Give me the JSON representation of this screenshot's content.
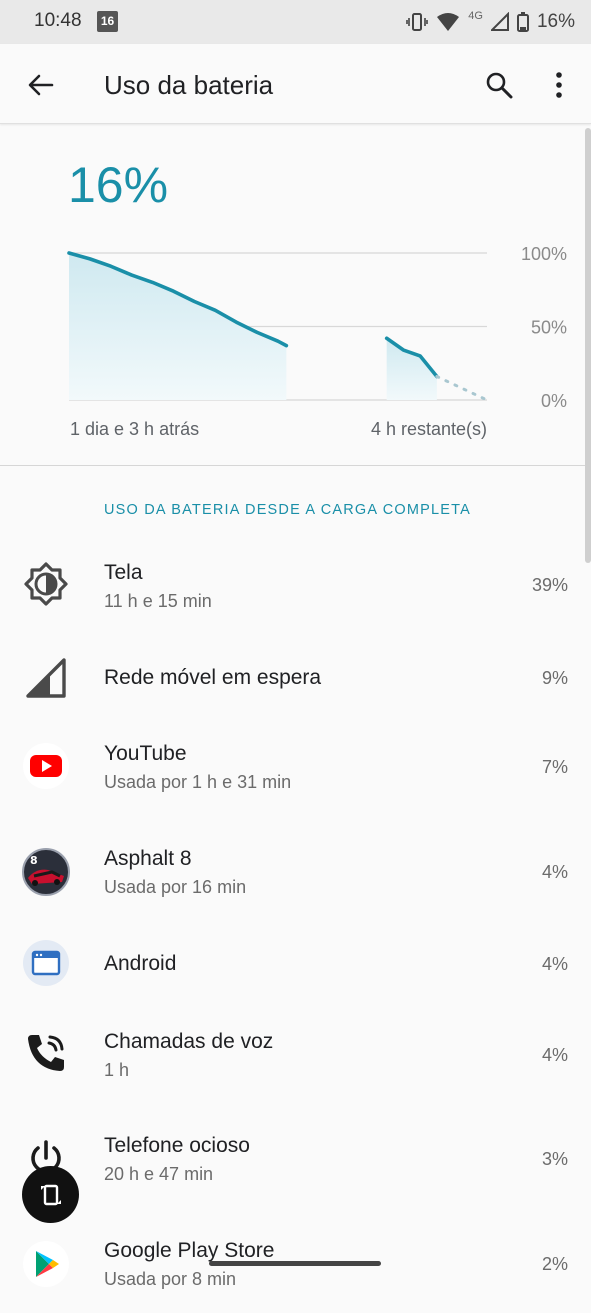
{
  "status_bar": {
    "time": "10:48",
    "notification_badge": "16",
    "network": "4G",
    "battery": "16%"
  },
  "app_bar": {
    "title": "Uso da bateria",
    "icons": [
      "back-arrow-icon",
      "search-icon",
      "more-vert-icon"
    ]
  },
  "summary": {
    "battery_percent": "16%",
    "time_ago": "1 dia e 3 h atrás",
    "time_remaining": "4 h restante(s)"
  },
  "chart_data": {
    "type": "area",
    "ylim": [
      0,
      100
    ],
    "ytick_labels": [
      "100%",
      "50%",
      "0%"
    ],
    "grid": true,
    "series": [
      {
        "x": [
          0,
          0.05,
          0.1,
          0.15,
          0.2,
          0.25,
          0.3,
          0.35,
          0.4,
          0.45,
          0.5,
          0.52
        ],
        "y": [
          100,
          96,
          91,
          85,
          80,
          74,
          67,
          61,
          53,
          46,
          40,
          37
        ]
      },
      {
        "x": [
          0.76,
          0.8,
          0.84,
          0.88
        ],
        "y": [
          42,
          34,
          30,
          16
        ]
      }
    ],
    "projection": {
      "x": [
        0.88,
        1.0
      ],
      "y": [
        16,
        0
      ]
    },
    "colors": {
      "line": "#1a8fa8",
      "fill": "#e3f3f7",
      "projection": "#a9c7d0",
      "grid": "#d8d8d8"
    }
  },
  "section_header": "USO DA BATERIA DESDE A CARGA COMPLETA",
  "items": [
    {
      "title": "Tela",
      "subtitle": "11 h e 15 min",
      "percent": "39%",
      "icon": "brightness-icon"
    },
    {
      "title": "Rede móvel em espera",
      "subtitle": "",
      "percent": "9%",
      "icon": "cell-signal-icon"
    },
    {
      "title": "YouTube",
      "subtitle": "Usada por 1 h e 31 min",
      "percent": "7%",
      "icon": "youtube-icon"
    },
    {
      "title": "Asphalt 8",
      "subtitle": "Usada por 16 min",
      "percent": "4%",
      "icon": "asphalt-8-icon"
    },
    {
      "title": "Android",
      "subtitle": "",
      "percent": "4%",
      "icon": "android-os-icon"
    },
    {
      "title": "Chamadas de voz",
      "subtitle": "1 h",
      "percent": "4%",
      "icon": "phone-call-icon"
    },
    {
      "title": "Telefone ocioso",
      "subtitle": "20 h e 47 min",
      "percent": "3%",
      "icon": "power-icon"
    },
    {
      "title": "Google Play Store",
      "subtitle": "Usada por 8 min",
      "percent": "2%",
      "icon": "play-store-icon"
    }
  ]
}
